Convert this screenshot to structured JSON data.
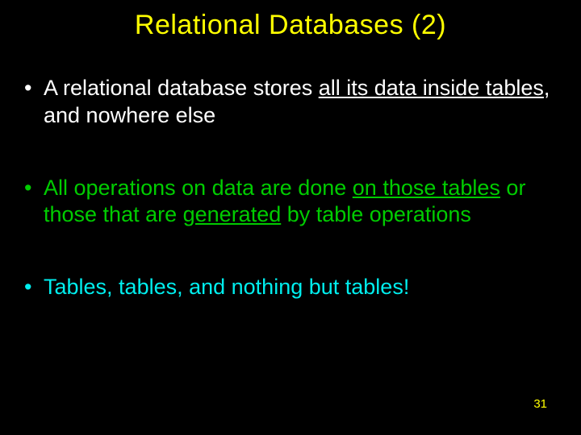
{
  "title": "Relational Databases (2)",
  "bullets": {
    "b1_p1": "A relational database stores ",
    "b1_u": "all its data inside tables",
    "b1_p2": ", and nowhere else",
    "b2_p1": "All operations on data are done ",
    "b2_u": "on those tables",
    "b2_p2": " or those that are ",
    "b2_u2": "generated",
    "b2_p3": " by table operations",
    "b3": "Tables, tables, and nothing but tables!"
  },
  "page_number": "31"
}
